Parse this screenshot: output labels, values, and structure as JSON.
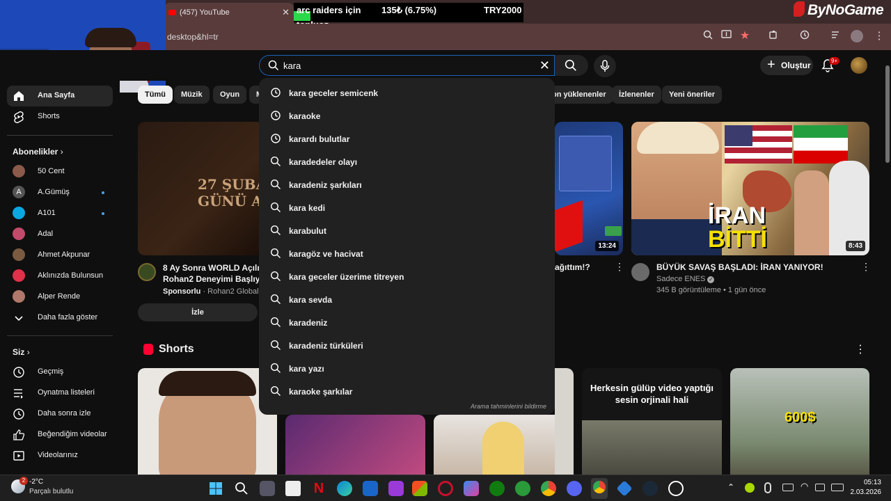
{
  "browser": {
    "tab_title": "(457) YouTube",
    "url": "desktop&hl=tr",
    "ticker": {
      "line1": "arc raiders için",
      "line1b": "topluoz",
      "pct": "135₺ (6.75%)",
      "goal": "TRY2000"
    },
    "brand": "ByNoGame"
  },
  "header": {
    "search_value": "kara",
    "create_label": "Oluştur",
    "notif_count": "9+"
  },
  "sidebar": {
    "home": "Ana Sayfa",
    "shorts": "Shorts",
    "subs_title": "Abonelikler",
    "channels": [
      "50 Cent",
      "A.Gümüş",
      "A101",
      "Adal",
      "Ahmet Akpunar",
      "Aklınızda Bulunsun",
      "Alper Rende"
    ],
    "show_more": "Daha fazla göster",
    "you_title": "Siz",
    "you_items": [
      "Geçmiş",
      "Oynatma listeleri",
      "Daha sonra izle",
      "Beğendiğim videolar",
      "Videolarınız"
    ]
  },
  "chips": [
    "Tümü",
    "Müzik",
    "Oyun",
    "M",
    "on yüklenenler",
    "İzlenenler",
    "Yeni öneriler"
  ],
  "suggestions": [
    "kara geceler semicenk",
    "karaoke",
    "karardı bulutlar",
    "karadedeler olayı",
    "karadeniz şarkıları",
    "kara kedi",
    "karabulut",
    "karagöz ve hacivat",
    "kara geceler üzerime titreyen",
    "kara sevda",
    "karadeniz",
    "karadeniz türküleri",
    "kara yazı",
    "karaoke şarkılar"
  ],
  "suggestion_history_count": 3,
  "report_text": "Arama tahminlerini bildirme",
  "videos": {
    "ad": {
      "thumb_text1": "27 ŞUBAT",
      "thumb_text2": "GÜNÜ AÇ",
      "title1": "8 Ay Sonra WORLD Açılıyo",
      "title2": "Rohan2 Deneyimi Başlıyor",
      "sponsor": "Sponsorlu",
      "channel": "Rohan2 Global",
      "cta": "İzle"
    },
    "v2": {
      "title": "ağıttım!?",
      "duration": "13:24"
    },
    "v3": {
      "title": "BÜYÜK SAVAŞ BAŞLADI: İRAN YANIYOR!",
      "channel": "Sadece ENES",
      "meta": "345 B görüntüleme • 1 gün önce",
      "duration": "8:43",
      "thumb_text1": "İRAN",
      "thumb_text2": "BİTTİ"
    }
  },
  "shorts_title": "Shorts",
  "shorts": {
    "s4_text": "Herkesin gülüp video yaptığı sesin orjinali hali",
    "s5_text": "600$"
  },
  "taskbar": {
    "temp": "-2°C",
    "weather": "Parçalı bulutlu",
    "time": "05:13",
    "date": "2.03.2026",
    "weather_badge": "2"
  },
  "colors": {
    "accent": "#3ea6ff",
    "yt_red": "#ff0000",
    "search_border": "#1c62b9"
  }
}
